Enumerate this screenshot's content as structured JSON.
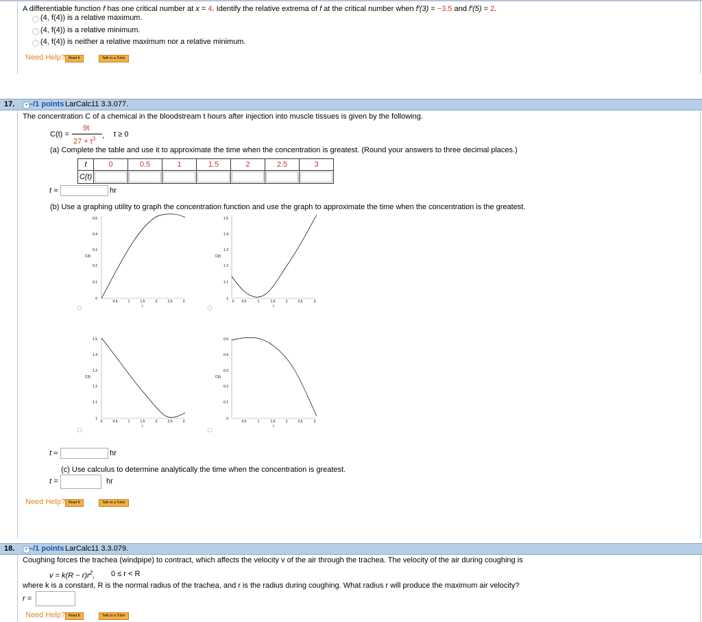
{
  "prev_question": {
    "prompt_pre": "A differentiable function ",
    "f": "f",
    "prompt_mid1": " has one critical number at ",
    "x_eq": "x",
    "eq": " = ",
    "crit_val": "4",
    "prompt_mid2": ". Identify the relative extrema of ",
    "prompt_mid3": " at the critical number when ",
    "fprime3": "f′(3)",
    "val1": "−3.5",
    "and": " and ",
    "fprime5": "f′(5)",
    "val2": "2",
    "period": ".",
    "options": [
      "(4, f(4)) is a relative maximum.",
      "(4, f(4)) is a relative minimum.",
      "(4, f(4)) is neither a relative maximum nor a relative minimum."
    ]
  },
  "help": {
    "need_help": "Need Help?",
    "read_it": "Read It",
    "talk_to_tutor": "Talk to a Tutor"
  },
  "q17": {
    "number": "17.",
    "points": "–/1 points",
    "code": "LarCalc11 3.3.077.",
    "prompt": "The concentration C of a chemical in the bloodstream t hours after injection into muscle tissues is given by the following.",
    "func_lhs": "C(t) =",
    "numerator": "9t",
    "denominator": "27 + t",
    "den_exp": "3",
    "comma": ",",
    "domain": "t ≥ 0",
    "part_a": "(a) Complete the table and use it to approximate the time when the concentration is greatest. (Round your answers to three decimal places.)",
    "table_t_label": "t",
    "table_c_label": "C(t)",
    "table_t_values": [
      "0",
      "0.5",
      "1",
      "1.5",
      "2",
      "2.5",
      "3"
    ],
    "t_approx": "t ≈",
    "unit": "hr",
    "part_b": "(b) Use a graphing utility to graph the concentration function and use the graph to approximate the time when the concentration is the greatest.",
    "t_approx2": "t ≈",
    "unit2": "hr",
    "part_c": "(c) Use calculus to determine analytically the time when the concentration is greatest.",
    "t_eq": "t =",
    "unit3": "hr"
  },
  "graphs": {
    "ylabel": "C(t)",
    "xlabel": "t",
    "x_ticks": [
      "0",
      "0.5",
      "1",
      "1.5",
      "2",
      "2.5",
      "3"
    ],
    "y_ticks_a": [
      "0",
      "0.1",
      "0.2",
      "0.3",
      "0.4",
      "0.5"
    ],
    "y_ticks_b": [
      "1",
      "1.1",
      "1.2",
      "1.3",
      "1.4",
      "1.5"
    ]
  },
  "q18": {
    "number": "18.",
    "points": "–/1 points",
    "code": "LarCalc11 3.3.079.",
    "prompt": "Coughing forces the trachea (windpipe) to contract, which affects the velocity v of the air through the trachea. The velocity of the air during coughing is",
    "formula": "v = k(R − r)r",
    "formula_exp": "2",
    "formula_tail": ",",
    "formula_domain": "0 ≤ r < R",
    "where": "where k is a constant, R is the normal radius of the trachea, and r is the radius during coughing. What radius r will produce the maximum air velocity?",
    "r_eq": "r ="
  },
  "colors": {
    "header_bg": "#b7cfe6",
    "points": "#1a55a8",
    "need_help": "#e0832a",
    "red_value": "#c0392b",
    "button": "#f5b041"
  }
}
